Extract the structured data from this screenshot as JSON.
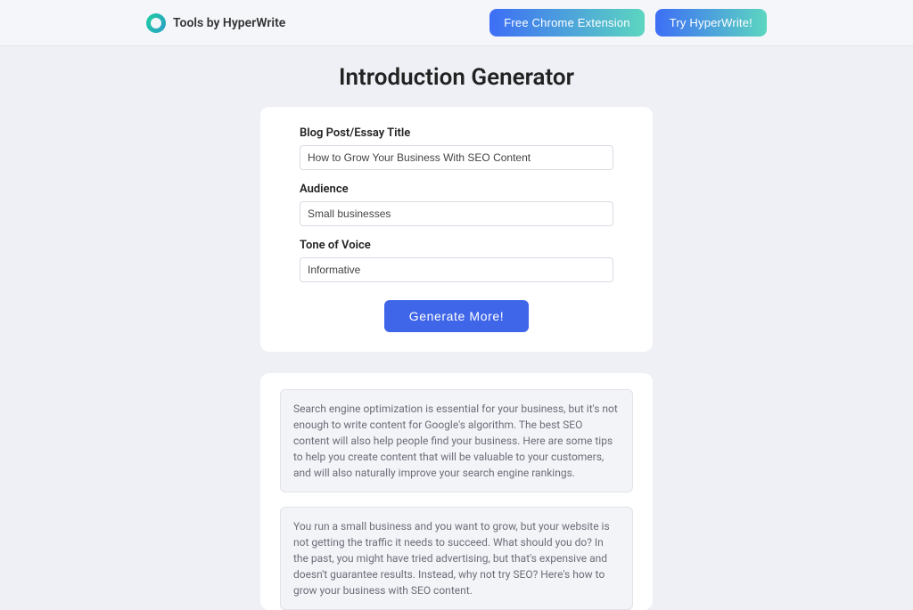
{
  "header": {
    "brand": "Tools by HyperWrite",
    "chrome_btn": "Free Chrome Extension",
    "try_btn": "Try HyperWrite!"
  },
  "page": {
    "title": "Introduction Generator"
  },
  "form": {
    "title_label": "Blog Post/Essay Title",
    "title_value": "How to Grow Your Business With SEO Content",
    "audience_label": "Audience",
    "audience_value": "Small businesses",
    "tone_label": "Tone of Voice",
    "tone_value": "Informative",
    "generate_label": "Generate More!"
  },
  "results": [
    "Search engine optimization is essential for your business, but it's not enough to write content for Google's algorithm. The best SEO content will also help people find your business. Here are some tips to help you create content that will be valuable to your customers, and will also naturally improve your search engine rankings.",
    "You run a small business and you want to grow, but your website is not getting the traffic it needs to succeed. What should you do? In the past, you might have tried advertising, but that's expensive and doesn't guarantee results. Instead, why not try SEO? Here's how to grow your business with SEO content."
  ]
}
